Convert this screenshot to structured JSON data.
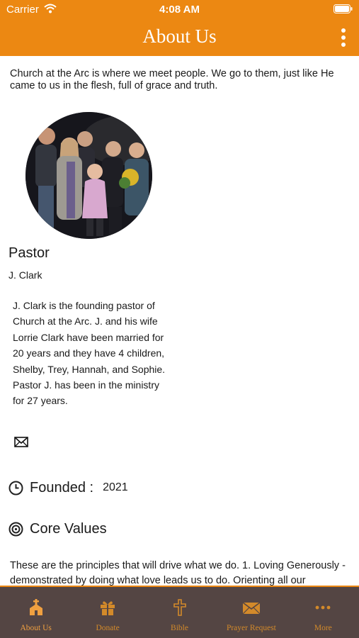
{
  "status_bar": {
    "carrier": "Carrier",
    "time": "4:08 AM"
  },
  "header": {
    "title": "About Us",
    "menu_icon": "more-vertical-icon"
  },
  "intro": "Church at the Arc is where we meet people. We go to them, just like He came to us in the flesh, full of grace and truth.",
  "pastor": {
    "heading": "Pastor",
    "name": "J. Clark",
    "bio": "J. Clark is the founding pastor of Church at the Arc.  J. and his wife  Lorrie Clark have been married for 20 years and they have 4 children, Shelby, Trey, Hannah, and Sophie.  Pastor J. has been in the ministry for 27 years.",
    "contact_icon": "mail-icon"
  },
  "founded": {
    "label": "Founded :",
    "value": "2021",
    "icon": "clock-icon"
  },
  "core_values": {
    "label": "Core Values",
    "icon": "target-icon",
    "text": "These are the principles that will drive what we do. 1. Loving Generously - demonstrated by doing what love leads us to do. Orienting all our"
  },
  "tabbar": {
    "items": [
      {
        "label": "About Us",
        "icon": "church-icon",
        "active": true
      },
      {
        "label": "Donate",
        "icon": "gift-icon",
        "active": false
      },
      {
        "label": "Bible",
        "icon": "cross-icon",
        "active": false
      },
      {
        "label": "Prayer Request",
        "icon": "envelope-icon",
        "active": false
      },
      {
        "label": "More",
        "icon": "more-horizontal-icon",
        "active": false
      }
    ]
  },
  "colors": {
    "accent": "#ec8812",
    "tabbar_bg": "#544543",
    "tab_label": "#d38a2a",
    "text": "#1a1a1a"
  }
}
